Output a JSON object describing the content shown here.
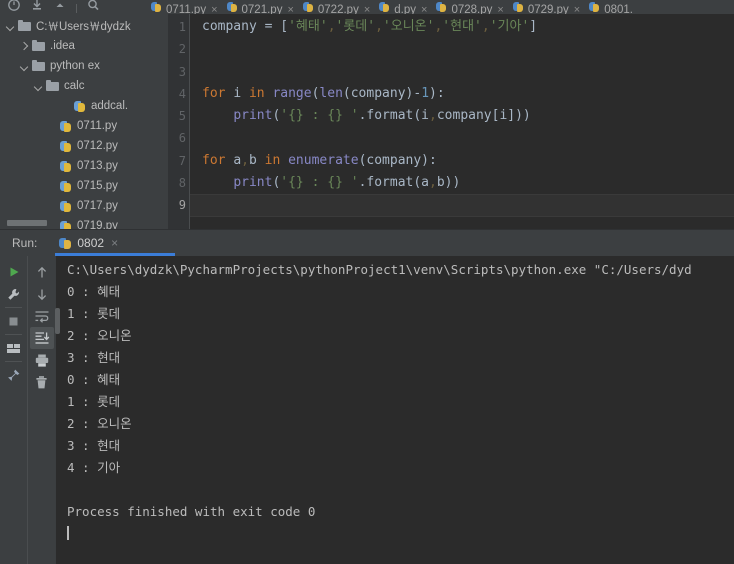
{
  "window": {
    "title": "PyCharm",
    "theme_bg": "#3c3f41",
    "editor_bg": "#2b2b2b",
    "accent": "#3b7dd8"
  },
  "toolbar": {
    "icons": [
      {
        "name": "vcs-update-icon",
        "glyph": "update"
      },
      {
        "name": "download-icon",
        "glyph": "download"
      },
      {
        "name": "push-up-icon",
        "glyph": "up"
      },
      {
        "name": "search-everywhere-icon",
        "glyph": "magnifier"
      }
    ]
  },
  "editor_tabs": [
    {
      "label": "0711.py",
      "close": "×",
      "active": false
    },
    {
      "label": "0721.py",
      "close": "×",
      "active": false
    },
    {
      "label": "0722.py",
      "close": "×",
      "active": false
    },
    {
      "label": "d.py",
      "close": "×",
      "active": false
    },
    {
      "label": "0728.py",
      "close": "×",
      "active": false
    },
    {
      "label": "0729.py",
      "close": "×",
      "active": false
    },
    {
      "label": "0801.",
      "close": "",
      "active": false
    }
  ],
  "project_tree": [
    {
      "label": "C:￦Users￦dydzk",
      "type": "folder",
      "arrow": "down",
      "indent": 0
    },
    {
      "label": ".idea",
      "type": "folder",
      "arrow": "right",
      "indent": 1
    },
    {
      "label": "python ex",
      "type": "folder",
      "arrow": "down",
      "indent": 1
    },
    {
      "label": "calc",
      "type": "folder",
      "arrow": "down",
      "indent": 2
    },
    {
      "label": "addcal.",
      "type": "pyfile",
      "arrow": "none",
      "indent": 4
    },
    {
      "label": "0711.py",
      "type": "pyfile",
      "arrow": "none",
      "indent": 3
    },
    {
      "label": "0712.py",
      "type": "pyfile",
      "arrow": "none",
      "indent": 3
    },
    {
      "label": "0713.py",
      "type": "pyfile",
      "arrow": "none",
      "indent": 3
    },
    {
      "label": "0715.py",
      "type": "pyfile",
      "arrow": "none",
      "indent": 3
    },
    {
      "label": "0717.py",
      "type": "pyfile",
      "arrow": "none",
      "indent": 3
    },
    {
      "label": "0719.py",
      "type": "pyfile",
      "arrow": "none",
      "indent": 3
    }
  ],
  "editor": {
    "line_numbers": [
      "1",
      "2",
      "3",
      "4",
      "5",
      "6",
      "7",
      "8",
      "9"
    ],
    "current_line": 9,
    "code_lines": [
      {
        "n": 1,
        "tokens": [
          {
            "t": "company ",
            "c": "p"
          },
          {
            "t": "= ",
            "c": "p"
          },
          {
            "t": "[",
            "c": "p"
          },
          {
            "t": "'혜태'",
            "c": "s"
          },
          {
            "t": ",",
            "c": "ws"
          },
          {
            "t": "'롯데'",
            "c": "s"
          },
          {
            "t": ",",
            "c": "ws"
          },
          {
            "t": "'오니온'",
            "c": "s"
          },
          {
            "t": ",",
            "c": "ws"
          },
          {
            "t": "'현대'",
            "c": "s"
          },
          {
            "t": ",",
            "c": "ws"
          },
          {
            "t": "'기아'",
            "c": "s"
          },
          {
            "t": "]",
            "c": "p"
          }
        ]
      },
      {
        "n": 2,
        "tokens": []
      },
      {
        "n": 3,
        "tokens": []
      },
      {
        "n": 4,
        "tokens": [
          {
            "t": "for ",
            "c": "k"
          },
          {
            "t": "i ",
            "c": "p"
          },
          {
            "t": "in ",
            "c": "k"
          },
          {
            "t": "range",
            "c": "f"
          },
          {
            "t": "(",
            "c": "p"
          },
          {
            "t": "len",
            "c": "f"
          },
          {
            "t": "(company)",
            "c": "p"
          },
          {
            "t": "-",
            "c": "p"
          },
          {
            "t": "1",
            "c": "n"
          },
          {
            "t": "):",
            "c": "p"
          }
        ]
      },
      {
        "n": 5,
        "tokens": [
          {
            "t": "    ",
            "c": "p"
          },
          {
            "t": "print",
            "c": "f"
          },
          {
            "t": "(",
            "c": "p"
          },
          {
            "t": "'{} : {} '",
            "c": "s"
          },
          {
            "t": ".format(i",
            "c": "p"
          },
          {
            "t": ",",
            "c": "ws"
          },
          {
            "t": "company[i]))",
            "c": "p"
          }
        ]
      },
      {
        "n": 6,
        "tokens": []
      },
      {
        "n": 7,
        "tokens": [
          {
            "t": "for ",
            "c": "k"
          },
          {
            "t": "a",
            "c": "p"
          },
          {
            "t": ",",
            "c": "ws"
          },
          {
            "t": "b ",
            "c": "p"
          },
          {
            "t": "in ",
            "c": "k"
          },
          {
            "t": "enumerate",
            "c": "f"
          },
          {
            "t": "(company):",
            "c": "p"
          }
        ]
      },
      {
        "n": 8,
        "tokens": [
          {
            "t": "    ",
            "c": "p"
          },
          {
            "t": "print",
            "c": "f"
          },
          {
            "t": "(",
            "c": "p"
          },
          {
            "t": "'{} : {} '",
            "c": "s"
          },
          {
            "t": ".format(a",
            "c": "p"
          },
          {
            "t": ",",
            "c": "ws"
          },
          {
            "t": "b))",
            "c": "p"
          }
        ]
      },
      {
        "n": 9,
        "tokens": []
      }
    ]
  },
  "run_panel": {
    "label": "Run:",
    "tab_name": "0802",
    "tab_close": "×",
    "toolbar_left": [
      {
        "name": "rerun-button",
        "glyph": "play"
      },
      {
        "name": "configure-button",
        "glyph": "wrench"
      },
      {
        "name": "stop-button",
        "glyph": "stop"
      },
      {
        "name": "layout-button",
        "glyph": "layout"
      },
      {
        "name": "pin-tab-button",
        "glyph": "pin"
      }
    ],
    "toolbar_right": [
      {
        "name": "up-the-stack-trace-button",
        "glyph": "arrow-up"
      },
      {
        "name": "down-the-stack-trace-button",
        "glyph": "arrow-down"
      },
      {
        "name": "soft-wrap-button",
        "glyph": "wrap"
      },
      {
        "name": "scroll-to-end-button",
        "glyph": "scroll-end",
        "selected": true
      },
      {
        "name": "print-button",
        "glyph": "printer"
      },
      {
        "name": "clear-all-button",
        "glyph": "trash"
      }
    ],
    "console_lines": [
      "C:\\Users\\dydzk\\PycharmProjects\\pythonProject1\\venv\\Scripts\\python.exe \"C:/Users/dyd",
      "0 : 혜태",
      "1 : 롯데",
      "2 : 오니온",
      "3 : 현대",
      "0 : 혜태",
      "1 : 롯데",
      "2 : 오니온",
      "3 : 현대",
      "4 : 기아",
      "",
      "Process finished with exit code 0"
    ]
  }
}
